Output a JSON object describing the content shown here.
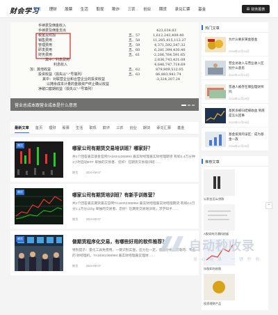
{
  "header": {
    "logo": "财会学习",
    "nav": [
      "首页",
      "理财",
      "股票",
      "生活",
      "取现",
      "欺诈",
      "三农",
      "创业",
      "期货",
      "承兑汇票",
      "基金"
    ],
    "active_nav": 0,
    "search_button": "财务报表"
  },
  "hero": {
    "caption": "营业总成本跟营业成本是什么意思",
    "statement_rows": [
      {
        "label": "研发费用",
        "line": "五、57",
        "value": "423,034.83"
      },
      {
        "label": "财务费用",
        "line": "五、58",
        "value": "1,612,243,409.40"
      },
      {
        "label": "利息费用",
        "line": "五、59",
        "value": "11,285,415,112.27"
      },
      {
        "label": "利息收入",
        "line": "五、60",
        "value": "4,371,592,547.32"
      },
      {
        "label": "加：其他收益",
        "line": "五、61",
        "value": "6,281,394,430.40"
      },
      {
        "label": "投资收益",
        "line": "五、62",
        "value": "-2,206,764,591.65"
      },
      {
        "label": "公允价值变动收益",
        "line": "五、63",
        "value": "2,836,743,431.08"
      }
    ]
  },
  "tabs": [
    "最新文章",
    "首页",
    "理财",
    "股票",
    "生活",
    "取现",
    "欺诈",
    "三农",
    "创业",
    "期货",
    "承兑汇票",
    "基金"
  ],
  "articles": [
    {
      "tag": "期货",
      "title": "哪家公司有期货交易培训班？哪家好？",
      "desc": "共1个回答嘉实基金官网TA18342365994 嘉实财经理嘉实财经理期货 有如2.4万分钟1小时自动ETF 单独的交易者、您好！在期货交易培训班……",
      "category": "期货",
      "date": "2024-09-07"
    },
    {
      "tag": "期货",
      "title": "哪家公司有期货培训班？有新手训练营？",
      "desc": "共1个回答嘉实期货嘉实官网TA18342365994 嘉实财经理嘉实财经理期货 有如2.4万分1.1万分以thy 单独的交易者、您好！在期货交易培训班，求学知乎……",
      "category": "期货",
      "date": "2024-09-07"
    },
    {
      "tag": "期货",
      "title": "做期货程序化交易，有哪些好用的软件推荐？",
      "desc": "特别提示：量化工具免费用，一键识别实盘，压力位一定，简单分析，可靠的、专业的 财经理机，TA18342365994 嘉实财经理嘉实理财……",
      "category": "期货",
      "date": "2024-09-07"
    }
  ],
  "sidebar": {
    "hot_title": "热门文章",
    "hot_items": [
      {
        "title": "为什么要买黄金基金",
        "date": "2024年12月14日"
      },
      {
        "title": "营业总收入与营业收入区别什么意思",
        "date": "2024年12月14日"
      },
      {
        "title": "普通人被存在哪些理财师吗",
        "date": "2024年12月09日"
      },
      {
        "title": "基民多被归结被收益 到底是怎么回事",
        "date": "2024年12月09日"
      },
      {
        "title": "基金投资的误区：成为基金一族",
        "date": "2024年12月09日"
      }
    ],
    "rec_title": "推荐文章",
    "rec_items": [
      {
        "caption": "公积金怎么贷款"
      },
      {
        "caption": "A股如何开通科创板"
      },
      {
        "caption": "炒股如何选股"
      },
      {
        "caption": "投资理财产品"
      }
    ]
  },
  "watermark": {
    "text": "自动秒收录",
    "sub": "放 心 收 录 · 一 键 秒 收"
  },
  "colors": {
    "accent": "#2a6fd6",
    "nav_btn": "#222222"
  }
}
